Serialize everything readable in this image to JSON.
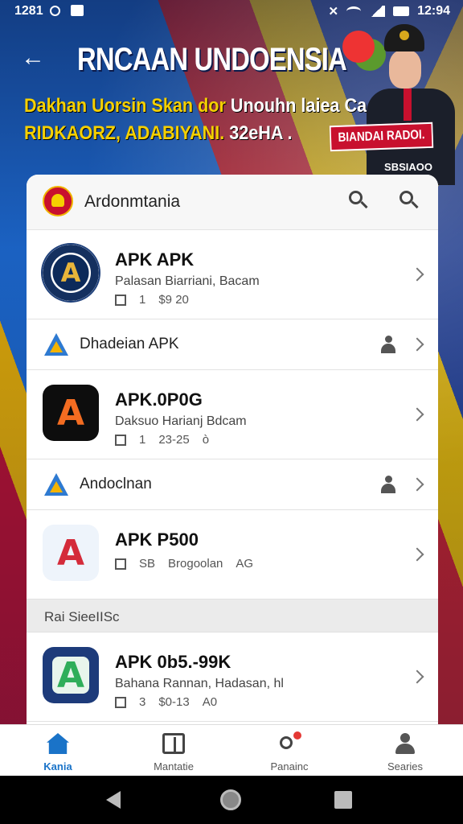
{
  "status": {
    "time": "1281",
    "clock": "12:94"
  },
  "header": {
    "title": "RNCAAN UNDOENSIA",
    "subtitle_line1_yellow": "Dakhan Uorsin Skan dor",
    "subtitle_line1_white": "Unouhn laiea Ca",
    "subtitle_line2_yellow": "RIDKAORZ, ADABIYANI.",
    "subtitle_line2_white": "32eHA .",
    "badge": "BIANDAI RADOI.",
    "badge_sub": "SBSIAOO"
  },
  "card": {
    "title": "Ardonmtania"
  },
  "apps": [
    {
      "name": "APK APK",
      "desc": "Palasan Biarriani, Bacam",
      "meta1": "1",
      "meta2": "$9 20",
      "meta3": ""
    },
    {
      "name": "APK.0P0G",
      "desc": "Daksuo Harianj Bdcam",
      "meta1": "1",
      "meta2": "23-25",
      "meta3": "ò"
    },
    {
      "name": "APK P500",
      "desc": "",
      "meta1": "SB",
      "meta2": "Brogoolan",
      "meta3": "AG"
    },
    {
      "name": "APK 0b5.-99K",
      "desc": "Bahana Rannan, Hadasan, hl",
      "meta1": "3",
      "meta2": "$0-13",
      "meta3": "A0"
    }
  ],
  "sections": [
    {
      "label": "Dhadeian APK"
    },
    {
      "label": "Andoclnan"
    }
  ],
  "band_label": "Rai SieeIISc",
  "nav": [
    {
      "label": "Kania"
    },
    {
      "label": "Mantatie"
    },
    {
      "label": "Panainc"
    },
    {
      "label": "Searies"
    }
  ],
  "icons": {
    "app1": "A",
    "app2": "A",
    "app3": "A",
    "app4": "A"
  },
  "colors": {
    "accent": "#1a73c8",
    "flag_red": "#c8102e",
    "yellow": "#f5d000"
  }
}
